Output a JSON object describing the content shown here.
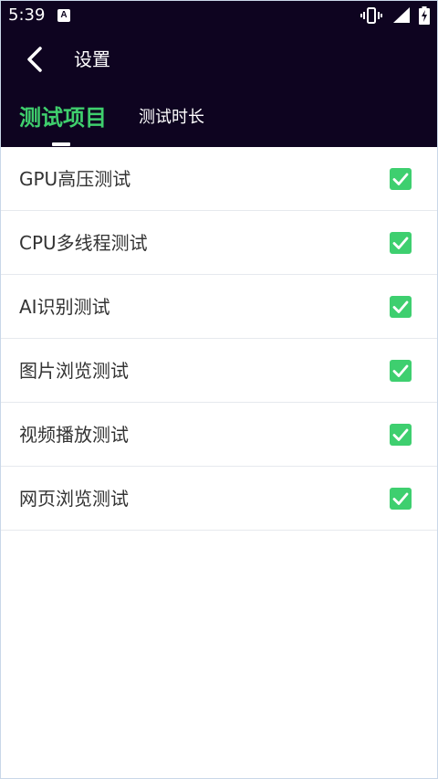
{
  "status_bar": {
    "time": "5:39",
    "badge": "A",
    "icons": [
      "vibrate-icon",
      "signal-icon",
      "battery-charging-icon"
    ]
  },
  "app_bar": {
    "back_icon": "chevron-left-icon",
    "title": "设置"
  },
  "tabs": [
    {
      "label": "测试项目",
      "active": true
    },
    {
      "label": "测试时长",
      "active": false
    }
  ],
  "colors": {
    "header_bg": "#0e0420",
    "accent_green": "#3fcf6d",
    "text_dark": "#333333"
  },
  "settings": {
    "items": [
      {
        "label": "GPU高压测试",
        "checked": true
      },
      {
        "label": "CPU多线程测试",
        "checked": true
      },
      {
        "label": "AI识别测试",
        "checked": true
      },
      {
        "label": "图片浏览测试",
        "checked": true
      },
      {
        "label": "视频播放测试",
        "checked": true
      },
      {
        "label": "网页浏览测试",
        "checked": true
      }
    ]
  }
}
